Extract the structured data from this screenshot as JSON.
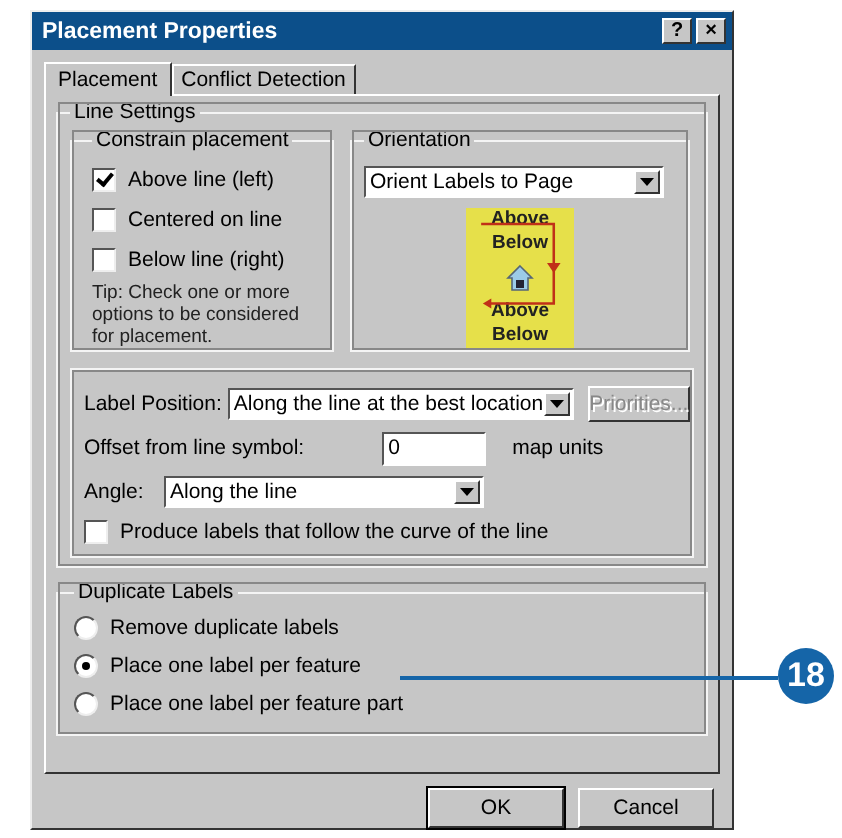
{
  "window": {
    "title": "Placement Properties",
    "title_buttons": [
      "?",
      "×"
    ]
  },
  "tabs": [
    {
      "label": "Placement",
      "selected": true
    },
    {
      "label": "Conflict Detection",
      "selected": false
    }
  ],
  "line_settings": {
    "title": "Line Settings",
    "constrain_placement": {
      "title": "Constrain placement",
      "options": [
        {
          "label": "Above line (left)",
          "checked": true
        },
        {
          "label": "Centered on line",
          "checked": false
        },
        {
          "label": "Below line (right)",
          "checked": false
        }
      ],
      "tip": "Tip:  Check one or more options to be considered for placement."
    },
    "orientation": {
      "title": "Orientation",
      "value": "Orient Labels to Page",
      "preview": [
        "Above",
        "Below",
        "Above",
        "Below"
      ]
    },
    "label_position": {
      "label": "Label Position:",
      "value": "Along the line at the best location"
    },
    "priorities_button": {
      "label": "Priorities...",
      "disabled": true
    },
    "offset": {
      "label": "Offset from line symbol:",
      "value": "0",
      "unit": "map units"
    },
    "angle": {
      "label": "Angle:",
      "value": "Along the line"
    },
    "follow_curve": {
      "label": "Produce labels that follow the curve of the line",
      "checked": false
    }
  },
  "duplicate_labels": {
    "title": "Duplicate Labels",
    "options": [
      {
        "label": "Remove duplicate labels",
        "selected": false
      },
      {
        "label": "Place one label per feature",
        "selected": true
      },
      {
        "label": "Place one label per feature part",
        "selected": false
      }
    ]
  },
  "buttons": [
    "OK",
    "Cancel"
  ],
  "callout": "18"
}
